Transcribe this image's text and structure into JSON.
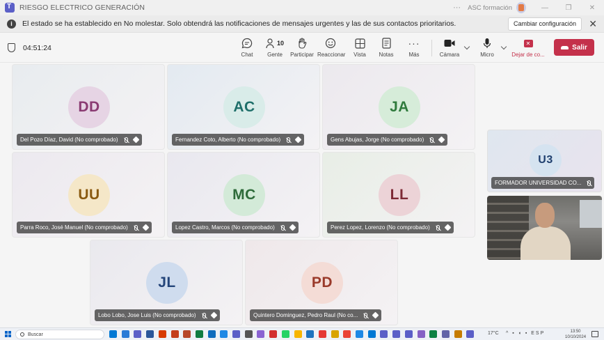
{
  "window": {
    "title": "RIESGO ELECTRICO GENERACIÓN",
    "more": "···",
    "org": "ASC formación",
    "controls": [
      "—",
      "❐",
      "✕"
    ]
  },
  "banner": {
    "text": "El estado se ha establecido en No molestar. Solo obtendrá las notificaciones de mensajes urgentes y las de sus contactos prioritarios.",
    "button": "Cambiar configuración",
    "close": "✕"
  },
  "toolbar": {
    "timer": "04:51:24",
    "chat": "Chat",
    "people": "Gente",
    "people_count": "10",
    "raise": "Participar",
    "react": "Reaccionar",
    "view": "Vista",
    "notes": "Notas",
    "more": "Más",
    "camera": "Cámara",
    "mic": "Micro",
    "share": "Dejar de co...",
    "leave": "Salir"
  },
  "participants": [
    {
      "initials": "DD",
      "name": "Del Pozo Díaz, David (No comprobado)",
      "bg": "#e8ecef",
      "avatar_bg": "#e6d4e4",
      "avatar_fg": "#8a3b72"
    },
    {
      "initials": "AC",
      "name": "Fernandez Coto, Alberto (No comprobado)",
      "bg": "#e3eaf1",
      "avatar_bg": "#d9ece9",
      "avatar_fg": "#1f6f6a"
    },
    {
      "initials": "JA",
      "name": "Gens Abujas, Jorge (No comprobado)",
      "bg": "#ece9ee",
      "avatar_bg": "#d6ecd9",
      "avatar_fg": "#2f7a3c"
    },
    {
      "initials": "UU",
      "name": "Parra Roco, José Manuel (No comprobado)",
      "bg": "#ece9ef",
      "avatar_bg": "#f5e7c8",
      "avatar_fg": "#8a5a10"
    },
    {
      "initials": "MC",
      "name": "Lopez Castro, Marcos (No comprobado)",
      "bg": "#e9e8ef",
      "avatar_bg": "#d3ead8",
      "avatar_fg": "#2e6b3a"
    },
    {
      "initials": "LL",
      "name": "Perez Lopez, Lorenzo (No comprobado)",
      "bg": "#e8eee6",
      "avatar_bg": "#ecd3d7",
      "avatar_fg": "#7d2a36"
    },
    {
      "initials": "JL",
      "name": "Lobo Lobo, Jose Luis (No comprobado)",
      "bg": "#eae9ee",
      "avatar_bg": "#cfdcee",
      "avatar_fg": "#24457a"
    },
    {
      "initials": "PD",
      "name": "Quintero Dominguez, Pedro Raul (No co...",
      "bg": "#efe8ea",
      "avatar_bg": "#f4dcd6",
      "avatar_fg": "#9a3a2a"
    }
  ],
  "side_participant": {
    "initials": "U3",
    "name": "FORMADOR UNIVERSIDAD CO...",
    "avatar_bg": "#d5e3f0",
    "avatar_fg": "#1f3f6e"
  },
  "taskbar": {
    "search_placeholder": "Buscar",
    "weather": "17°C",
    "time": "13:50",
    "date": "10/10/2024",
    "tray": "^ ▪ ◖ ▪ ESP"
  }
}
